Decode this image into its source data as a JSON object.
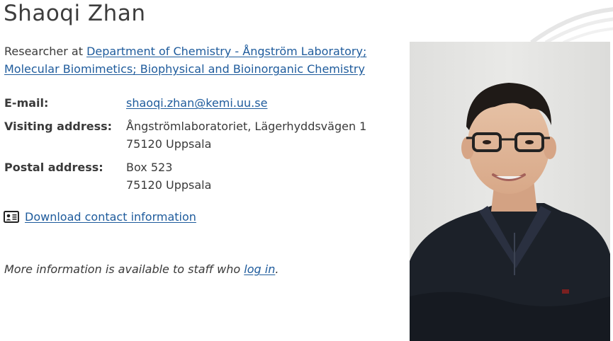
{
  "profile": {
    "name": "Shaoqi Zhan",
    "role_prefix": "Researcher at ",
    "affiliation_link": "Department of Chemistry - Ångström Laboratory; Molecular Biomimetics; Biophysical and Bioinorganic Chemistry"
  },
  "contact": {
    "email_label": "E-mail:",
    "email": "shaoqi.zhan@kemi.uu.se",
    "visiting_label": "Visiting address:",
    "visiting_line1": "Ångströmlaboratoriet, Lägerhyddsvägen 1",
    "visiting_line2": "75120 Uppsala",
    "postal_label": "Postal address:",
    "postal_line1": "Box 523",
    "postal_line2": "75120 Uppsala"
  },
  "download": {
    "icon": "vcard-icon",
    "label": "Download contact information"
  },
  "staff_note": {
    "prefix": "More information is available to staff who ",
    "link": "log in",
    "suffix": "."
  },
  "photo": {
    "alt": "portrait-photo"
  }
}
